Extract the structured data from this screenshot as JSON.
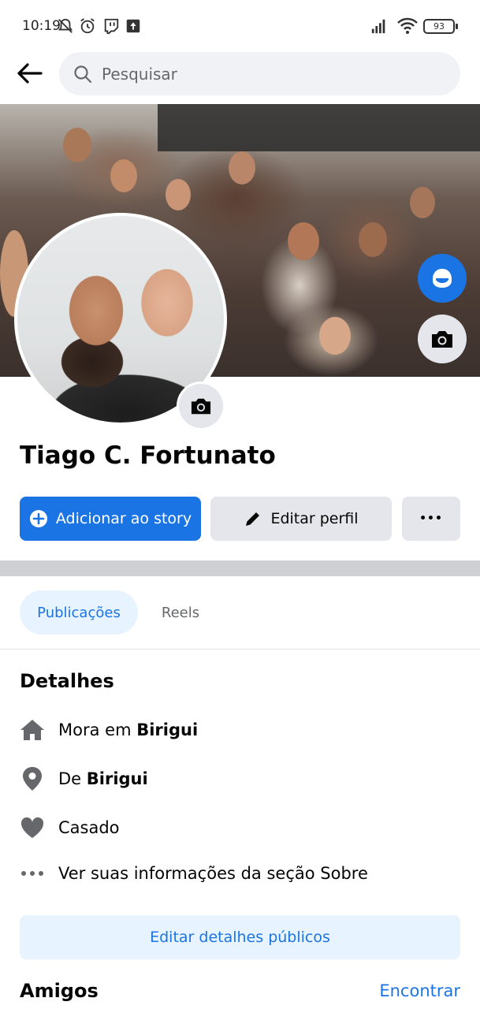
{
  "status_bar": {
    "time": "10:19",
    "battery": "93",
    "icons": [
      "notifications-off-icon",
      "alarm-icon",
      "twitch-icon",
      "upload-icon",
      "signal-icon",
      "wifi-icon",
      "battery-icon"
    ]
  },
  "header": {
    "back_icon": "arrow-left-icon",
    "search_placeholder": "Pesquisar",
    "search_icon": "search-icon"
  },
  "profile": {
    "name": "Tiago C. Fortunato"
  },
  "actions": {
    "add_story_label": "Adicionar ao story",
    "edit_profile_label": "Editar perfil",
    "more_label": "•••"
  },
  "tabs": [
    {
      "label": "Publicações",
      "active": true
    },
    {
      "label": "Reels",
      "active": false
    }
  ],
  "details": {
    "title": "Detalhes",
    "items": [
      {
        "icon": "home-icon",
        "prefix": "Mora em ",
        "value": "Birigui"
      },
      {
        "icon": "location-pin-icon",
        "prefix": "De ",
        "value": "Birigui"
      },
      {
        "icon": "heart-icon",
        "prefix": "",
        "value": "Casado"
      },
      {
        "icon": "more-dots-icon",
        "prefix": "",
        "value": "Ver suas informações da seção Sobre"
      }
    ],
    "edit_public_label": "Editar detalhes públicos"
  },
  "friends": {
    "title": "Amigos",
    "find_label": "Encontrar"
  },
  "colors": {
    "primary": "#1b74e4",
    "secondary_bg": "#e4e6eb",
    "light_blue_bg": "#e7f3ff",
    "divider": "#ced0d4"
  }
}
